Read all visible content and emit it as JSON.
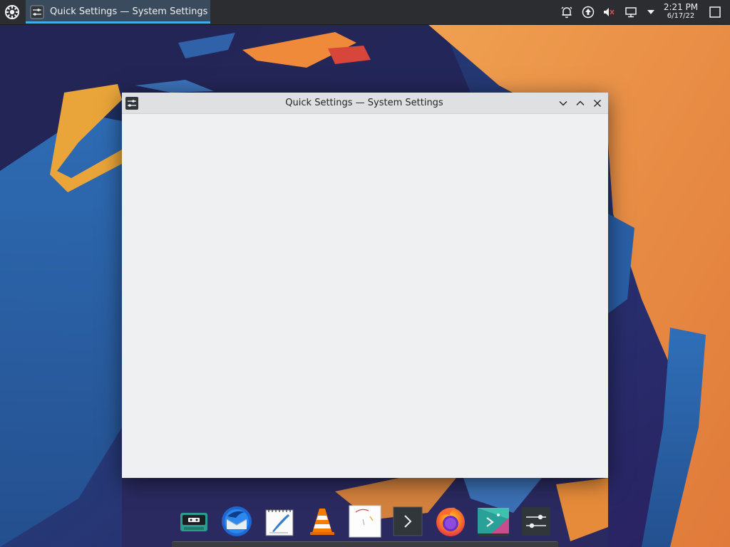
{
  "top_panel": {
    "launcher_icon": "app-launcher-icon",
    "task": {
      "label": "Quick Settings  — System Settings",
      "icon": "settings-sliders-icon"
    },
    "tray": [
      {
        "icon": "notification-bell-icon"
      },
      {
        "icon": "update-arrow-icon"
      },
      {
        "icon": "volume-muted-icon"
      },
      {
        "icon": "display-icon"
      },
      {
        "icon": "tray-expand-arrow-icon"
      }
    ],
    "clock": {
      "time": "2:21 PM",
      "date": "6/17/22"
    },
    "show_desktop_icon": "show-desktop-icon"
  },
  "window": {
    "title": "Quick Settings — System Settings",
    "icon": "settings-sliders-icon",
    "buttons": [
      "minimize",
      "maximize",
      "close"
    ]
  },
  "dock": [
    {
      "name": "cassette-player-app",
      "icon": "cassette-icon"
    },
    {
      "name": "thunderbird-app",
      "icon": "thunderbird-icon"
    },
    {
      "name": "text-editor-app",
      "icon": "notepad-quill-icon"
    },
    {
      "name": "vlc-app",
      "icon": "vlc-cone-icon"
    },
    {
      "name": "drawing-app",
      "icon": "drawing-canvas-icon"
    },
    {
      "name": "terminal-app",
      "icon": "terminal-chevron-icon"
    },
    {
      "name": "firefox-app",
      "icon": "firefox-icon"
    },
    {
      "name": "discover-app",
      "icon": "discover-store-icon"
    },
    {
      "name": "system-settings-app",
      "icon": "settings-sliders-icon"
    }
  ],
  "colors": {
    "panel": "#2b2d31",
    "accent": "#3daee9",
    "window_bg": "#eff0f1",
    "titlebar": "#dee0e2"
  }
}
